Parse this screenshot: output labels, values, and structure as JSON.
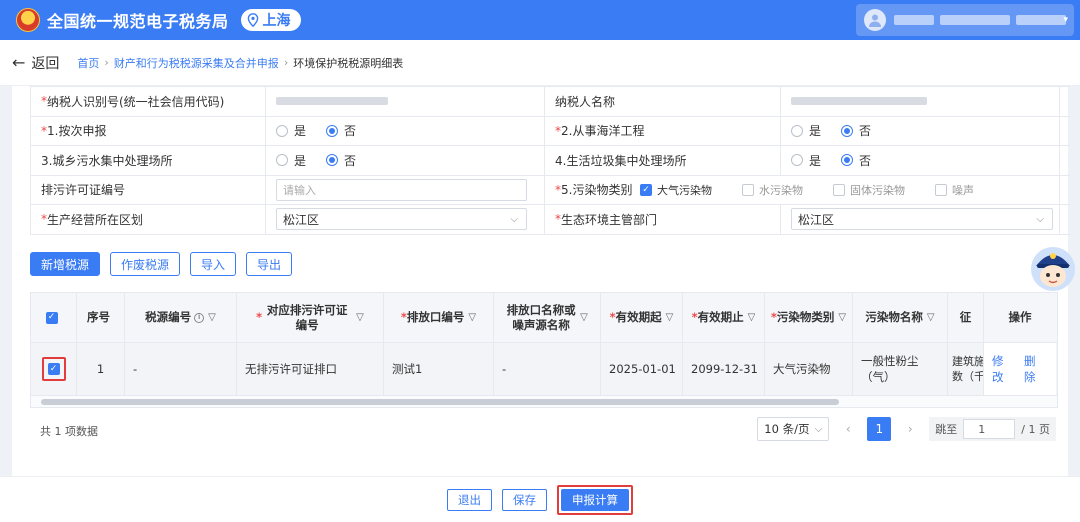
{
  "header": {
    "site_title": "全国统一规范电子税务局",
    "city": "上海"
  },
  "nav": {
    "back_label": "返回",
    "breadcrumbs": [
      "首页",
      "财产和行为税税源采集及合并申报",
      "环境保护税税源明细表"
    ]
  },
  "form": {
    "taxpayer_id_label": "纳税人识别号(统一社会信用代码)",
    "taxpayer_name_label": "纳税人名称",
    "by_time_label": "1.按次申报",
    "marine_label": "2.从事海洋工程",
    "sewage_label": "3.城乡污水集中处理场所",
    "garbage_label": "4.生活垃圾集中处理场所",
    "permit_no_label": "排污许可证编号",
    "permit_no_placeholder": "请输入",
    "pollutant_type_label": "5.污染物类别",
    "district_label": "生产经营所在区划",
    "district_value": "松江区",
    "env_dept_label": "生态环境主管部门",
    "env_dept_value": "松江区",
    "yes": "是",
    "no": "否",
    "pollutants": [
      "大气污染物",
      "水污染物",
      "固体污染物",
      "噪声"
    ],
    "pollutants_checked": [
      true,
      false,
      false,
      false
    ],
    "radio_selected": "否"
  },
  "toolbar": {
    "add": "新增税源",
    "void": "作废税源",
    "import": "导入",
    "export": "导出"
  },
  "table": {
    "headers": {
      "no": "序号",
      "code": "税源编号",
      "permit": "对应排污许可证编号",
      "outlet": "排放口编号",
      "outlet_name": "排放口名称或噪声源名称",
      "start": "有效期起",
      "end": "有效期止",
      "type": "污染物类别",
      "pname": "污染物名称",
      "extra": "征",
      "op": "操作"
    },
    "rows": [
      {
        "no": "1",
        "code": "-",
        "permit": "无排污许可证排口",
        "outlet": "测试1",
        "outlet_name": "-",
        "start": "2025-01-01",
        "end": "2099-12-31",
        "type": "大气污染物",
        "pname": "一般性粉尘（气）",
        "extra_line1": "建筑施",
        "extra_line2": "数（千",
        "edit": "修改",
        "delete": "删除",
        "checked": true
      }
    ]
  },
  "pagination": {
    "total": "共 1 项数据",
    "page_size": "10 条/页",
    "current_page": "1",
    "jump_label": "跳至",
    "jump_value": "1",
    "page_total": "/ 1 页"
  },
  "actions": {
    "exit": "退出",
    "save": "保存",
    "submit": "申报计算"
  },
  "colors": {
    "primary": "#3a7cf3",
    "required": "#f04848",
    "highlight": "#e23c3c"
  }
}
